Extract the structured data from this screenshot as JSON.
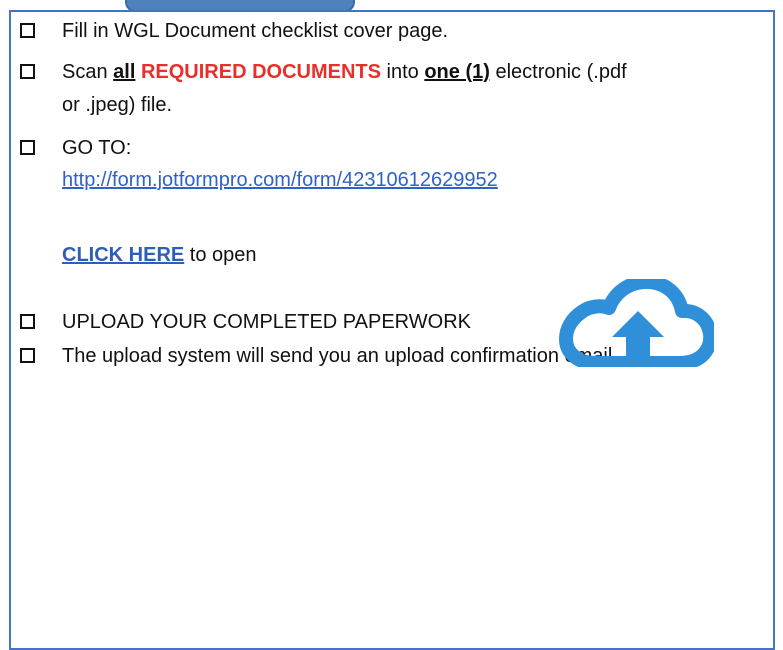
{
  "checklist": {
    "item1": "Fill in WGL Document checklist cover page.",
    "item2": {
      "prefix": "Scan ",
      "all": "all",
      "required": "REQUIRED DOCUMENTS",
      "into": " into ",
      "one": "one (1)",
      "rest": " electronic (.pdf",
      "line2": "or .jpeg) file."
    },
    "item3": {
      "goto": "GO TO:",
      "url": "http://form.jotformpro.com/form/42310612629952",
      "click_here": "CLICK HERE",
      "to_open": " to open"
    },
    "item4": "UPLOAD YOUR COMPLETED PAPERWORK",
    "item5": "The upload system will send you an upload confirmation email."
  },
  "colors": {
    "frame": "#4472c4",
    "required": "#e8302b",
    "link": "#2e62c9",
    "cloud": "#2f8fd8"
  },
  "icons": {
    "cloud": "cloud-upload-icon",
    "checkbox": "empty-checkbox-icon"
  }
}
